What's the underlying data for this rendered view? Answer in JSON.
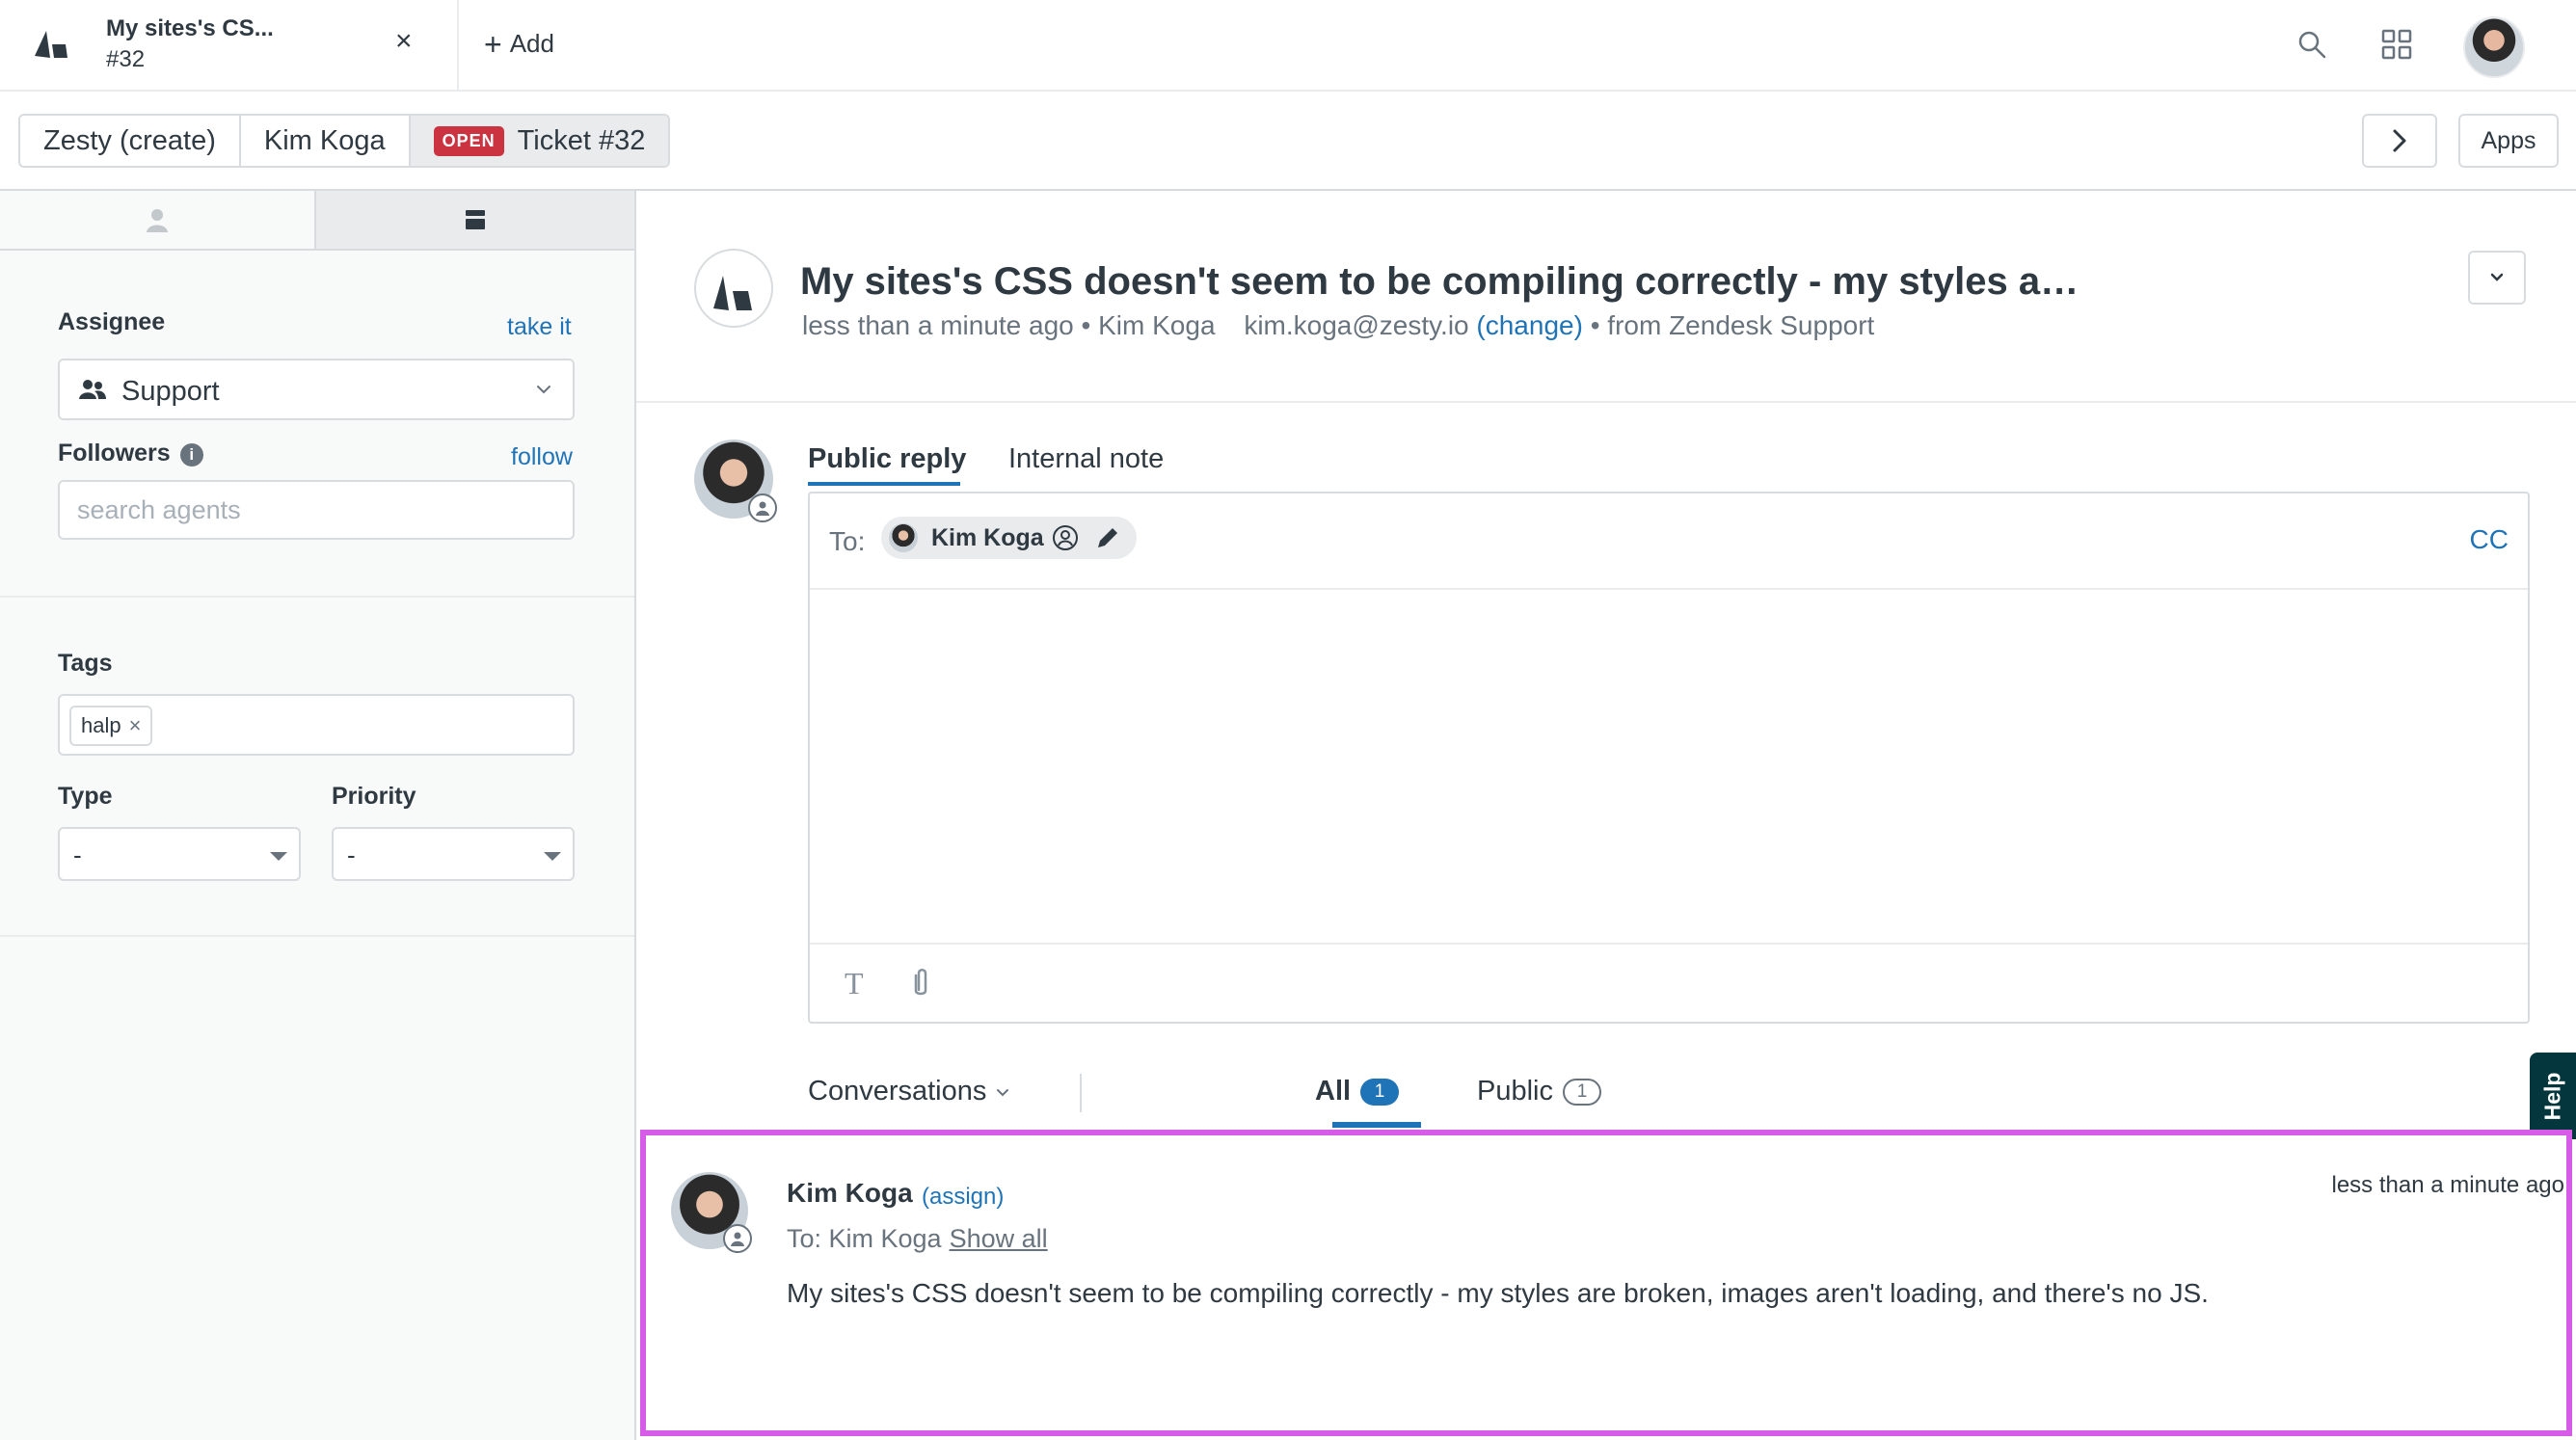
{
  "browser_tab": {
    "title": "My sites's CS...",
    "subtitle": "#32",
    "close_label": "×",
    "add_label": "Add"
  },
  "breadcrumbs": {
    "items": [
      "Zesty (create)",
      "Kim Koga",
      "Ticket #32"
    ],
    "status_badge": "OPEN"
  },
  "toolbar": {
    "apps_label": "Apps"
  },
  "sidebar": {
    "assignee_label": "Assignee",
    "take_it_label": "take it",
    "assignee_value": "Support",
    "followers_label": "Followers",
    "follow_label": "follow",
    "followers_placeholder": "search agents",
    "tags_label": "Tags",
    "tags": [
      "halp"
    ],
    "type_label": "Type",
    "type_value": "-",
    "priority_label": "Priority",
    "priority_value": "-"
  },
  "ticket": {
    "title": "My sites's CSS doesn't seem to be compiling correctly - my styles are broken, images aren'...",
    "meta_time": "less than a minute ago",
    "meta_requester": "Kim Koga",
    "meta_email": "kim.koga@zesty.io",
    "meta_change": "(change)",
    "meta_source": "from Zendesk Support"
  },
  "reply": {
    "tabs": [
      "Public reply",
      "Internal note"
    ],
    "to_label": "To:",
    "to_recipient": "Kim Koga",
    "cc_label": "CC",
    "text_format_glyph": "T"
  },
  "conversations": {
    "filter_label": "Conversations",
    "tabs": [
      {
        "label": "All",
        "count": "1"
      },
      {
        "label": "Public",
        "count": "1"
      }
    ],
    "help_label": "Help"
  },
  "comment": {
    "author": "Kim Koga",
    "assign_label": "(assign)",
    "time": "less than a minute ago",
    "to_text": "To: Kim Koga",
    "show_all_label": "Show all",
    "body": "My sites's CSS doesn't seem to be compiling correctly - my styles are broken, images aren't loading, and there's no JS."
  },
  "colors": {
    "accent_blue": "#1f73b7",
    "open_red": "#cc3340",
    "highlight_magenta": "#d65ce8",
    "help_dark": "#03363d"
  }
}
